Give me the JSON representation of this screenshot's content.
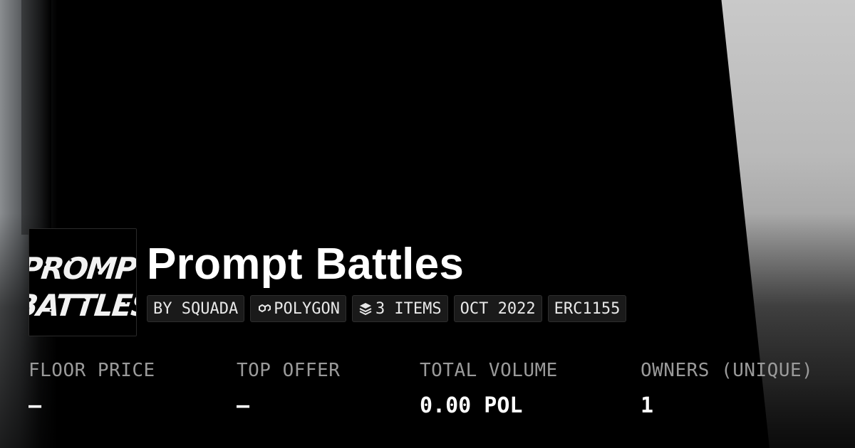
{
  "collection": {
    "logo_text_line1": "PROMPT",
    "logo_text_line2": "BATTLES",
    "title": "Prompt Battles"
  },
  "chips": {
    "creator": "BY SQUADA",
    "chain": "POLYGON",
    "chain_icon": "polygon-link-icon",
    "items": "3 ITEMS",
    "items_icon": "layers-icon",
    "date": "OCT 2022",
    "standard": "ERC1155"
  },
  "stats": {
    "floor_price_label": "FLOOR PRICE",
    "floor_price_value": "–",
    "top_offer_label": "TOP OFFER",
    "top_offer_value": "–",
    "total_volume_label": "TOTAL VOLUME",
    "total_volume_value": "0.00 POL",
    "owners_label": "OWNERS (UNIQUE)",
    "owners_value": "1"
  },
  "colors": {
    "background": "#000000",
    "chip_background": "#1c1c1c",
    "label_gray": "#9a9a9a",
    "text_white": "#ffffff"
  }
}
